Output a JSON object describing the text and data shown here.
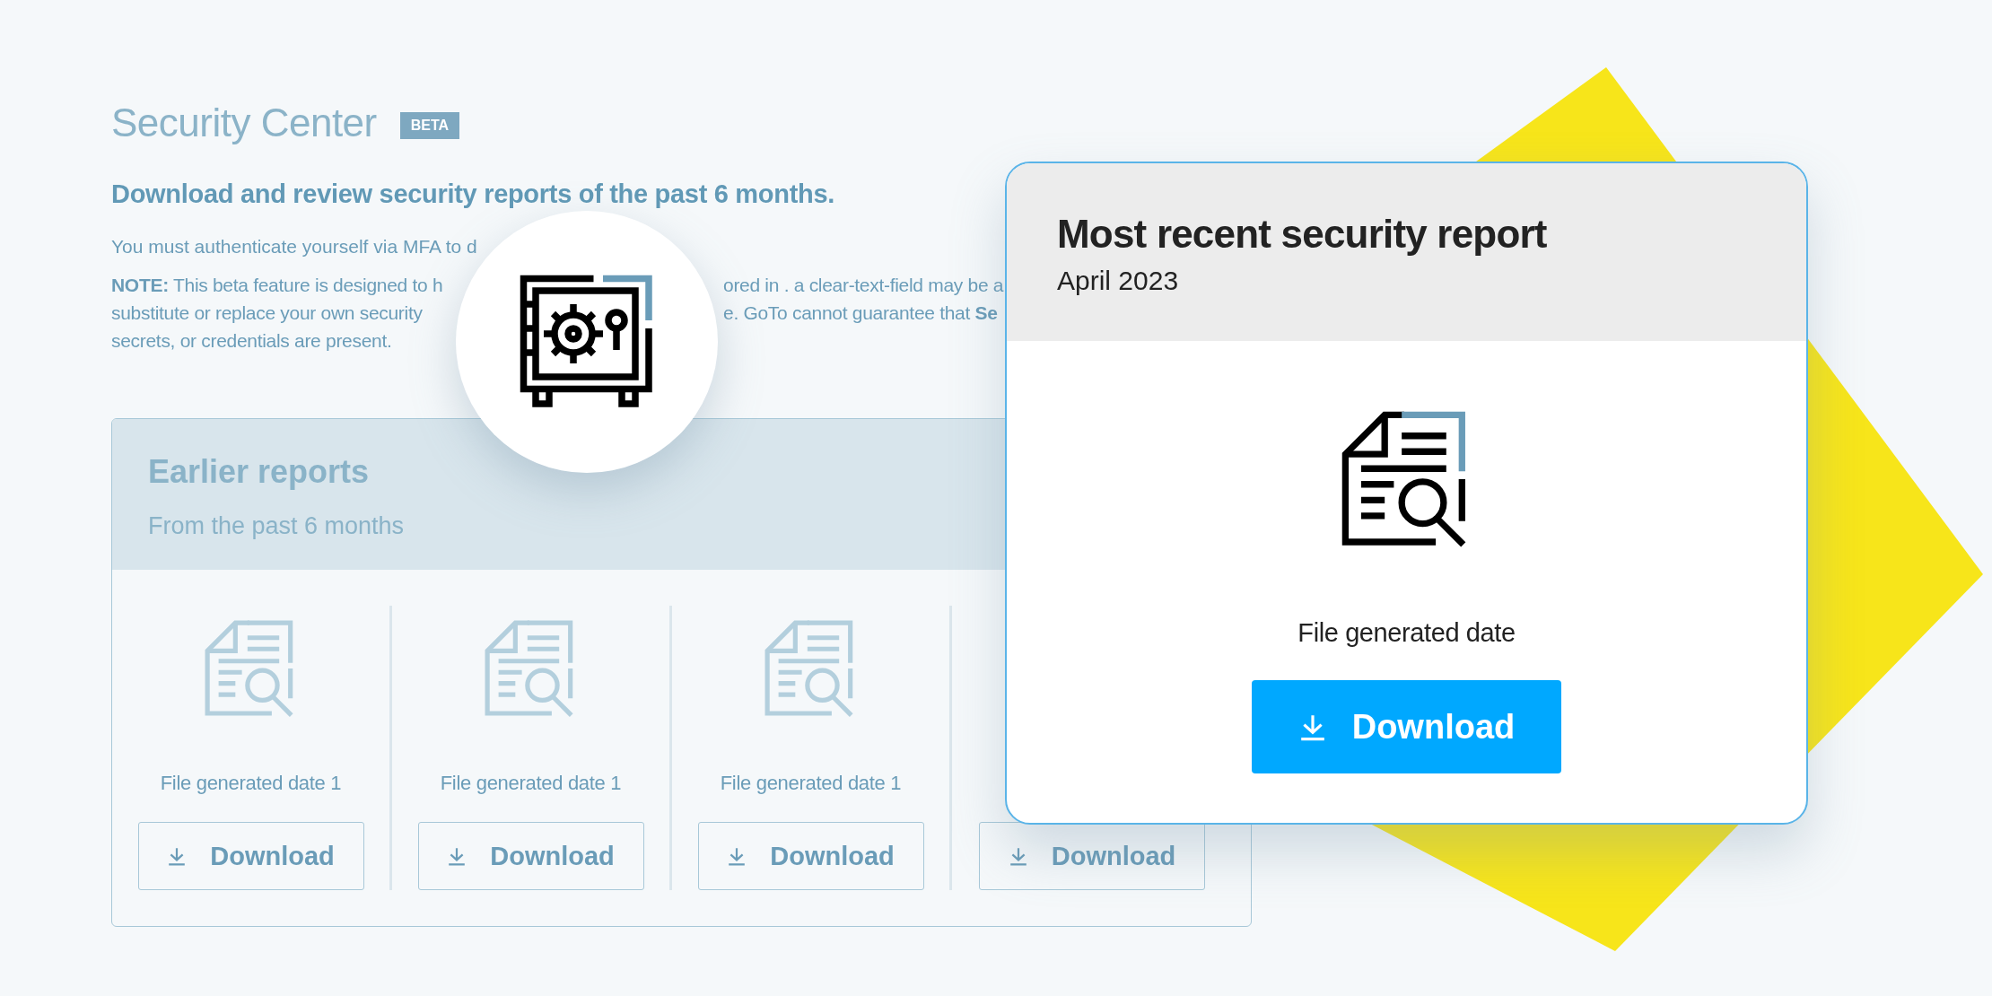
{
  "header": {
    "title": "Security Center",
    "badge": "BETA",
    "subtitle": "Download and review security reports of the past 6 months."
  },
  "auth_notice": "You must authenticate yourself via MFA to d",
  "note_lines": [
    {
      "left": "**NOTE:** This beta feature is designed to h",
      "right": "ored in . a clear-text-field may be a"
    },
    {
      "left": "substitute or replace your own security",
      "right": "e. GoTo cannot guarantee that **Se**"
    },
    {
      "left": "secrets, or credentials are present."
    }
  ],
  "earlier_reports": {
    "title": "Earlier reports",
    "subtitle": "From the past 6 months",
    "reports": [
      {
        "date": "File generated date 1",
        "button": "Download"
      },
      {
        "date": "File generated date 1",
        "button": "Download"
      },
      {
        "date": "File generated date 1",
        "button": "Download"
      },
      {
        "button": "Download"
      }
    ]
  },
  "recent_report": {
    "title": "Most recent security report",
    "month": "April 2023",
    "date": "File generated date",
    "button": "Download"
  }
}
